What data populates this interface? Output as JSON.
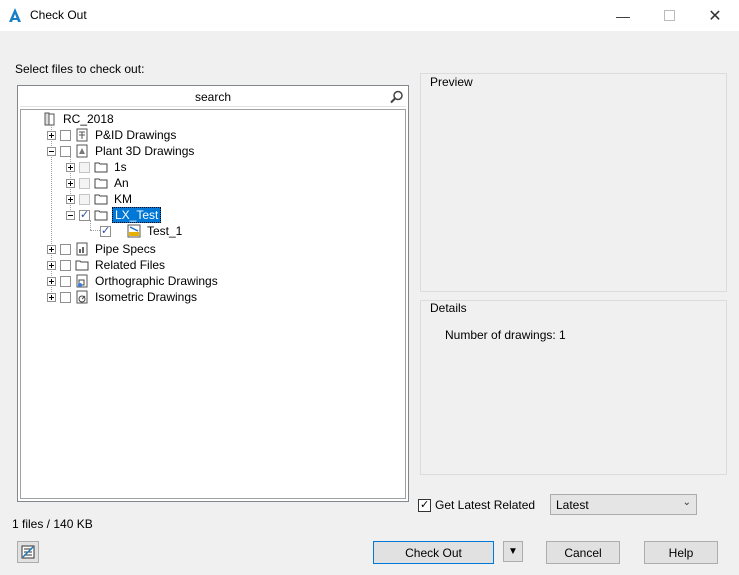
{
  "window": {
    "title": "Check Out",
    "minimize_icon": "minimize-icon",
    "maximize_icon": "maximize-icon",
    "close_icon": "close-icon"
  },
  "select_label": "Select files to check out:",
  "search": {
    "value": "search",
    "icon": "magnifier-icon"
  },
  "tree": {
    "root": "RC_2018",
    "items": [
      {
        "label": "P&ID Drawings"
      },
      {
        "label": "Plant 3D Drawings"
      },
      {
        "label": "1s"
      },
      {
        "label": "An"
      },
      {
        "label": "KM"
      },
      {
        "label": "LX_Test"
      },
      {
        "label": "Test_1"
      },
      {
        "label": "Pipe Specs"
      },
      {
        "label": "Related Files"
      },
      {
        "label": "Orthographic Drawings"
      },
      {
        "label": "Isometric Drawings"
      }
    ]
  },
  "preview": {
    "label": "Preview"
  },
  "details": {
    "label": "Details",
    "num_drawings": "Number of drawings: 1"
  },
  "get_latest": {
    "label": "Get Latest Related",
    "checked": true,
    "selected": "Latest"
  },
  "status": {
    "file_summary": "1 files / 140 KB"
  },
  "buttons": {
    "check_out": "Check Out",
    "cancel": "Cancel",
    "help": "Help"
  },
  "colors": {
    "accent": "#0078d7",
    "dialog_bg": "#f0f0f0"
  }
}
